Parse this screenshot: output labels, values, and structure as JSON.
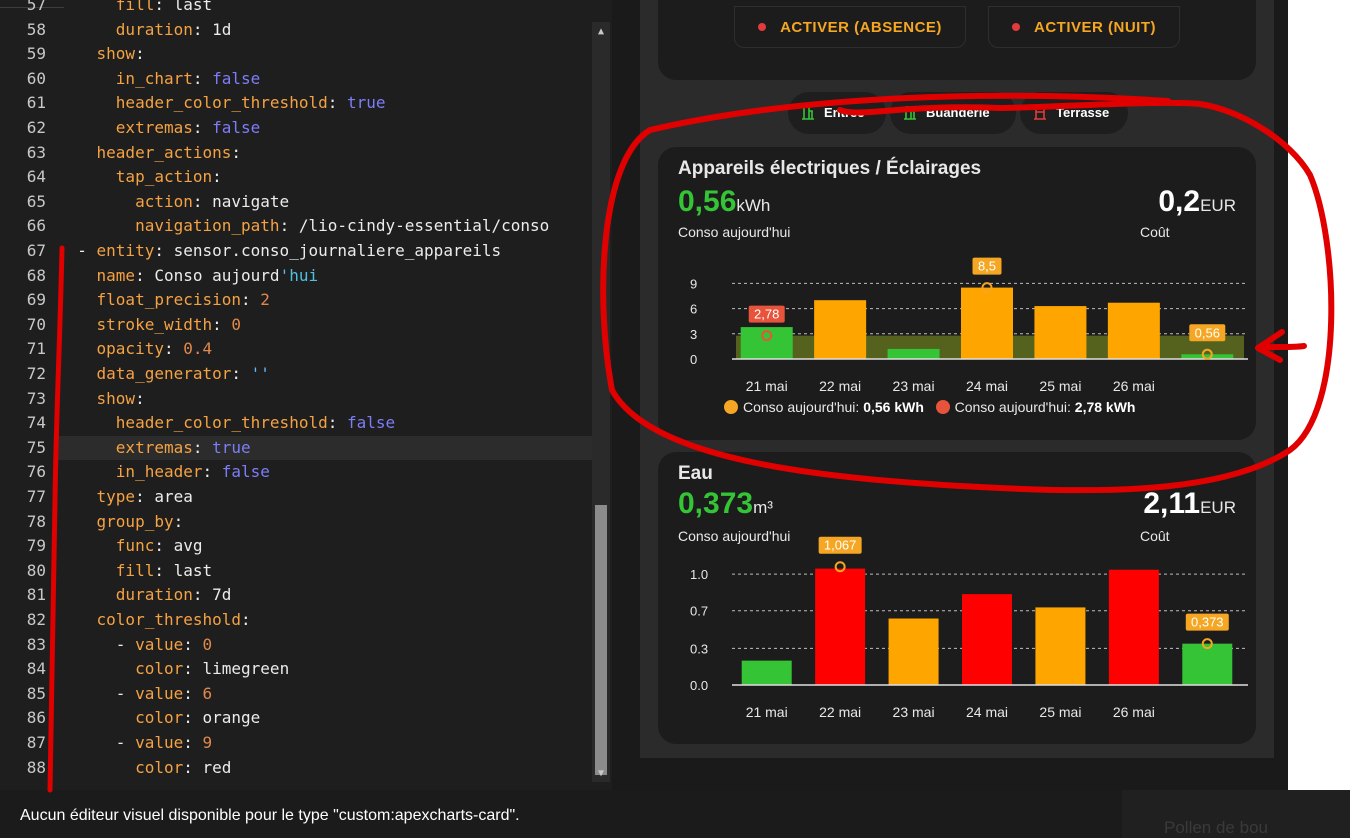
{
  "editor": {
    "lines": [
      {
        "num": "57",
        "html": "      <span class='k'>fill</span>: last",
        "tokens": []
      },
      {
        "num": "58",
        "parts": [
          [
            "      ",
            ""
          ],
          [
            "duration",
            "k"
          ],
          [
            ": 1d",
            ""
          ]
        ]
      },
      {
        "num": "59",
        "parts": [
          [
            "    ",
            ""
          ],
          [
            "show",
            "k"
          ],
          [
            ":",
            ""
          ]
        ]
      },
      {
        "num": "60",
        "parts": [
          [
            "      ",
            ""
          ],
          [
            "in_chart",
            "k"
          ],
          [
            ": ",
            ""
          ],
          [
            "false",
            "bool"
          ]
        ]
      },
      {
        "num": "61",
        "parts": [
          [
            "      ",
            ""
          ],
          [
            "header_color_threshold",
            "k"
          ],
          [
            ": ",
            ""
          ],
          [
            "true",
            "bool"
          ]
        ]
      },
      {
        "num": "62",
        "parts": [
          [
            "      ",
            ""
          ],
          [
            "extremas",
            "k"
          ],
          [
            ": ",
            ""
          ],
          [
            "false",
            "bool"
          ]
        ]
      },
      {
        "num": "63",
        "parts": [
          [
            "    ",
            ""
          ],
          [
            "header_actions",
            "k"
          ],
          [
            ":",
            ""
          ]
        ]
      },
      {
        "num": "64",
        "parts": [
          [
            "      ",
            ""
          ],
          [
            "tap_action",
            "k"
          ],
          [
            ":",
            ""
          ]
        ]
      },
      {
        "num": "65",
        "parts": [
          [
            "        ",
            ""
          ],
          [
            "action",
            "k"
          ],
          [
            ": navigate",
            ""
          ]
        ]
      },
      {
        "num": "66",
        "parts": [
          [
            "        ",
            ""
          ],
          [
            "navigation_path",
            "k"
          ],
          [
            ": /lio-cindy-essential/conso",
            ""
          ]
        ]
      },
      {
        "num": "67",
        "parts": [
          [
            "  - ",
            ""
          ],
          [
            "entity",
            "k"
          ],
          [
            ": sensor.conso_journaliere_appareils",
            ""
          ]
        ]
      },
      {
        "num": "68",
        "parts": [
          [
            "    ",
            ""
          ],
          [
            "name",
            "k"
          ],
          [
            ": Conso aujourd",
            ""
          ],
          [
            "'hui",
            "strq"
          ]
        ]
      },
      {
        "num": "69",
        "parts": [
          [
            "    ",
            ""
          ],
          [
            "float_precision",
            "k"
          ],
          [
            ": ",
            ""
          ],
          [
            "2",
            "num"
          ]
        ]
      },
      {
        "num": "70",
        "parts": [
          [
            "    ",
            ""
          ],
          [
            "stroke_width",
            "k"
          ],
          [
            ": ",
            ""
          ],
          [
            "0",
            "num"
          ]
        ]
      },
      {
        "num": "71",
        "parts": [
          [
            "    ",
            ""
          ],
          [
            "opacity",
            "k"
          ],
          [
            ": ",
            ""
          ],
          [
            "0.4",
            "num"
          ]
        ]
      },
      {
        "num": "72",
        "parts": [
          [
            "    ",
            ""
          ],
          [
            "data_generator",
            "k"
          ],
          [
            ": ",
            ""
          ],
          [
            "''",
            "str"
          ]
        ]
      },
      {
        "num": "73",
        "parts": [
          [
            "    ",
            ""
          ],
          [
            "show",
            "k"
          ],
          [
            ":",
            ""
          ]
        ]
      },
      {
        "num": "74",
        "parts": [
          [
            "      ",
            ""
          ],
          [
            "header_color_threshold",
            "k"
          ],
          [
            ": ",
            ""
          ],
          [
            "false",
            "bool"
          ]
        ]
      },
      {
        "num": "75",
        "parts": [
          [
            "      ",
            ""
          ],
          [
            "extremas",
            "k"
          ],
          [
            ": ",
            ""
          ],
          [
            "true",
            "bool"
          ]
        ],
        "active": true
      },
      {
        "num": "76",
        "parts": [
          [
            "      ",
            ""
          ],
          [
            "in_header",
            "k"
          ],
          [
            ": ",
            ""
          ],
          [
            "false",
            "bool"
          ]
        ]
      },
      {
        "num": "77",
        "parts": [
          [
            "    ",
            ""
          ],
          [
            "type",
            "k"
          ],
          [
            ": area",
            ""
          ]
        ]
      },
      {
        "num": "78",
        "parts": [
          [
            "    ",
            ""
          ],
          [
            "group_by",
            "k"
          ],
          [
            ":",
            ""
          ]
        ]
      },
      {
        "num": "79",
        "parts": [
          [
            "      ",
            ""
          ],
          [
            "func",
            "k"
          ],
          [
            ": avg",
            ""
          ]
        ]
      },
      {
        "num": "80",
        "parts": [
          [
            "      ",
            ""
          ],
          [
            "fill",
            "k"
          ],
          [
            ": last",
            ""
          ]
        ]
      },
      {
        "num": "81",
        "parts": [
          [
            "      ",
            ""
          ],
          [
            "duration",
            "k"
          ],
          [
            ": 7d",
            ""
          ]
        ]
      },
      {
        "num": "82",
        "parts": [
          [
            "    ",
            ""
          ],
          [
            "color_threshold",
            "k"
          ],
          [
            ":",
            ""
          ]
        ]
      },
      {
        "num": "83",
        "parts": [
          [
            "      - ",
            ""
          ],
          [
            "value",
            "k"
          ],
          [
            ": ",
            ""
          ],
          [
            "0",
            "num"
          ]
        ]
      },
      {
        "num": "84",
        "parts": [
          [
            "        ",
            ""
          ],
          [
            "color",
            "k"
          ],
          [
            ": limegreen",
            ""
          ]
        ]
      },
      {
        "num": "85",
        "parts": [
          [
            "      - ",
            ""
          ],
          [
            "value",
            "k"
          ],
          [
            ": ",
            ""
          ],
          [
            "6",
            "num"
          ]
        ]
      },
      {
        "num": "86",
        "parts": [
          [
            "        ",
            ""
          ],
          [
            "color",
            "k"
          ],
          [
            ": orange",
            ""
          ]
        ]
      },
      {
        "num": "87",
        "parts": [
          [
            "      - ",
            ""
          ],
          [
            "value",
            "k"
          ],
          [
            ": ",
            ""
          ],
          [
            "9",
            "num"
          ]
        ]
      },
      {
        "num": "88",
        "parts": [
          [
            "        ",
            ""
          ],
          [
            "color",
            "k"
          ],
          [
            ": red",
            ""
          ]
        ]
      }
    ]
  },
  "footer": {
    "message": "Aucun éditeur visuel disponible pour le type \"custom:apexcharts-card\".",
    "background_text": "Pollen de bou"
  },
  "preview": {
    "actions": [
      {
        "label": "ACTIVER (ABSENCE)",
        "dot_color": "#e33b3b"
      },
      {
        "label": "ACTIVER (NUIT)",
        "dot_color": "#e33b3b"
      }
    ],
    "rooms": [
      {
        "label": "Entree",
        "icon": "building-icon",
        "icon_color": "#35c435"
      },
      {
        "label": "Buanderie",
        "icon": "building-icon",
        "icon_color": "#35c435"
      },
      {
        "label": "Terrasse",
        "icon": "building-icon",
        "icon_color": "#e33b3b"
      }
    ],
    "elec": {
      "title": "Appareils électriques / Éclairages",
      "value": "0,56",
      "unit": "kWh",
      "value_label": "Conso aujourd'hui",
      "cost": "0,2",
      "cost_unit": "EUR",
      "cost_label": "Coût",
      "legend": [
        {
          "color": "#f5a623",
          "text": "Conso aujourd'hui: ",
          "bold": "0,56 kWh"
        },
        {
          "color": "#e8533b",
          "text": "Conso aujourd'hui: ",
          "bold": "2,78 kWh"
        }
      ]
    },
    "eau": {
      "title": "Eau",
      "value": "0,373",
      "unit": "m³",
      "value_label": "Conso aujourd'hui",
      "cost": "2,11",
      "cost_unit": "EUR",
      "cost_label": "Coût"
    }
  },
  "chart_data": [
    {
      "type": "bar",
      "title": "Appareils électriques / Éclairages",
      "categories": [
        "21 mai",
        "22 mai",
        "23 mai",
        "24 mai",
        "25 mai",
        "26 mai",
        ""
      ],
      "series": [
        {
          "name": "Conso aujourd'hui",
          "values": [
            3.8,
            7.0,
            1.2,
            8.5,
            6.3,
            6.7,
            0.56
          ],
          "colors": [
            "#35c435",
            "#ffa500",
            "#35c435",
            "#ffa500",
            "#ffa500",
            "#ffa500",
            "#35c435"
          ]
        }
      ],
      "area_value": 2.78,
      "ylim": [
        0,
        10
      ],
      "yticks": [
        "0",
        "3",
        "6",
        "9"
      ],
      "ytick_values": [
        0,
        3,
        6,
        9
      ],
      "annotations": [
        {
          "index": 0,
          "value": 2.78,
          "label": "2,78",
          "color": "#e8533b"
        },
        {
          "index": 3,
          "value": 8.5,
          "label": "8,5",
          "color": "#f5a623"
        },
        {
          "index": 6,
          "value": 0.56,
          "label": "0,56",
          "color": "#f5a623"
        }
      ],
      "grid": true
    },
    {
      "type": "bar",
      "title": "Eau",
      "categories": [
        "21 mai",
        "22 mai",
        "23 mai",
        "24 mai",
        "25 mai",
        "26 mai",
        ""
      ],
      "series": [
        {
          "name": "Conso aujourd'hui",
          "values": [
            0.22,
            1.05,
            0.6,
            0.82,
            0.7,
            1.04,
            0.373
          ],
          "colors": [
            "#35c435",
            "#ff0000",
            "#ffa500",
            "#ff0000",
            "#ffa500",
            "#ff0000",
            "#35c435"
          ]
        }
      ],
      "ylim": [
        0,
        1.2
      ],
      "yticks": [
        "0.0",
        "0.3",
        "0.7",
        "1.0"
      ],
      "ytick_values": [
        0,
        0.33,
        0.67,
        1.0
      ],
      "annotations": [
        {
          "index": 1,
          "value": 1.067,
          "label": "1,067",
          "color": "#f5a623"
        },
        {
          "index": 6,
          "value": 0.373,
          "label": "0,373",
          "color": "#f5a623"
        }
      ],
      "grid": true
    }
  ]
}
